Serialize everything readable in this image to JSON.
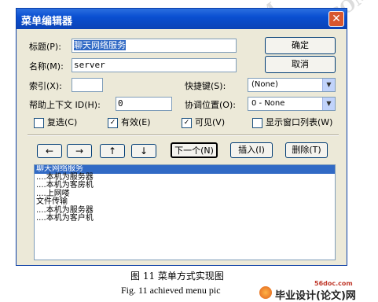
{
  "dialog": {
    "title": "菜单编辑器",
    "close_glyph": "✕",
    "caption_label": "标题(P):",
    "caption_value": "聊天网络服务",
    "name_label": "名称(M):",
    "name_value": "server",
    "index_label": "索引(X):",
    "index_value": "",
    "shortcut_label": "快捷键(S):",
    "shortcut_value": "(None)",
    "help_label": "帮助上下文 ID(H):",
    "help_value": "0",
    "negotiate_label": "协调位置(O):",
    "negotiate_value": "0 - None",
    "ok_label": "确定",
    "cancel_label": "取消",
    "checkboxes": {
      "checked_label": "复选(C)",
      "checked_state": false,
      "enabled_label": "有效(E)",
      "enabled_state": true,
      "visible_label": "可见(V)",
      "visible_state": true,
      "windowlist_label": "显示窗口列表(W)",
      "windowlist_state": false
    },
    "arrows": {
      "left": "←",
      "right": "→",
      "up": "↑",
      "down": "↓"
    },
    "next_label": "下一个(N)",
    "insert_label": "插入(I)",
    "delete_label": "删除(T)",
    "menu_items": [
      {
        "text": "聊天网络服务",
        "selected": true
      },
      {
        "text": "....本机为服务器",
        "selected": false
      },
      {
        "text": "....本机为客房机",
        "selected": false
      },
      {
        "text": "....上网喽",
        "selected": false
      },
      {
        "text": "文件传输",
        "selected": false
      },
      {
        "text": "....本机为服务器",
        "selected": false
      },
      {
        "text": "....本机为客户机",
        "selected": false
      }
    ]
  },
  "caption": {
    "zh": "图 11   菜单方式实现图",
    "en": "Fig. 11    achieved menu pic"
  },
  "watermark": {
    "site": "56DOC.COM",
    "logo_small": "56doc.com",
    "logo_text": "毕业设计(论文)网"
  },
  "colors": {
    "titlebar": "#0a4fd1",
    "close": "#d8572f",
    "selection": "#316ac5",
    "dialog_bg": "#ece9d8"
  }
}
